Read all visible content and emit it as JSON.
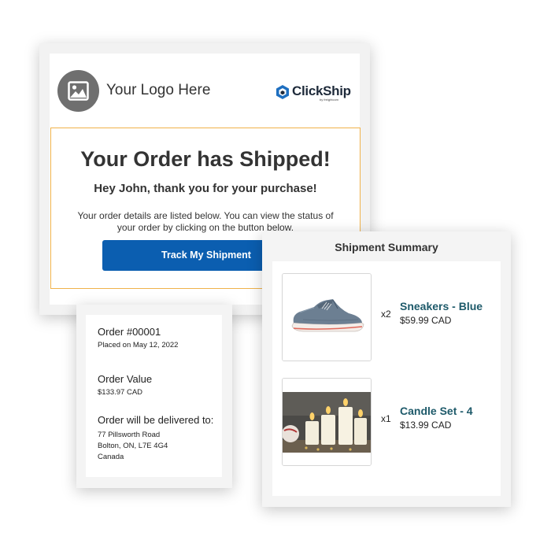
{
  "email": {
    "logo_text": "Your Logo Here",
    "brand_name": "ClickShip",
    "brand_sub": "by freightcom",
    "title": "Your Order has Shipped!",
    "greeting": "Hey John, thank you for your purchase!",
    "details": "Your order details are listed below. You can view the status of your order by clicking on the button below.",
    "button_label": "Track My Shipment",
    "colors": {
      "button": "#0b5eb0",
      "body_border": "#f0b24a",
      "brand": "#1e2a3a"
    }
  },
  "order": {
    "number": "Order #00001",
    "placed_on": "Placed on May 12, 2022",
    "value_label": "Order Value",
    "value": "$133.97 CAD",
    "delivery_label": "Order will be delivered to:",
    "address_line1": "77 Pillsworth Road",
    "address_line2": "Bolton, ON, L7E 4G4",
    "address_line3": "Canada"
  },
  "summary": {
    "title": "Shipment Summary",
    "items": [
      {
        "qty": "x2",
        "name": "Sneakers - Blue",
        "price": "$59.99 CAD",
        "icon": "sneaker-image"
      },
      {
        "qty": "x1",
        "name": "Candle Set - 4",
        "price": "$13.99 CAD",
        "icon": "candles-image"
      }
    ],
    "colors": {
      "item_name": "#1e5a6a"
    }
  }
}
